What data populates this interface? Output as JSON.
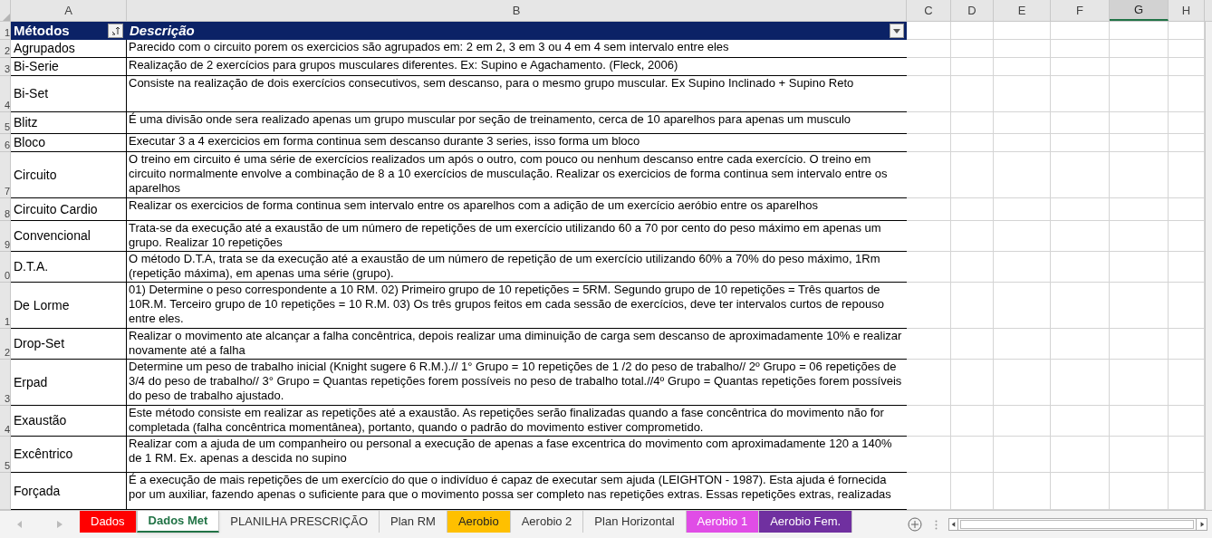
{
  "column_headers": [
    {
      "label": "A",
      "selected": false
    },
    {
      "label": "B",
      "selected": false
    },
    {
      "label": "C",
      "selected": false
    },
    {
      "label": "D",
      "selected": false
    },
    {
      "label": "E",
      "selected": false
    },
    {
      "label": "F",
      "selected": false
    },
    {
      "label": "G",
      "selected": true
    },
    {
      "label": "H",
      "selected": false
    }
  ],
  "table": {
    "header_row_number": "1",
    "columns": [
      "Métodos",
      "Descrição"
    ],
    "rows": [
      {
        "row_number": "2",
        "method": "Agrupados",
        "description": "Parecido com o circuito porem os exercicios são agrupados em: 2 em 2, 3 em 3 ou 4 em 4 sem intervalo entre eles"
      },
      {
        "row_number": "3",
        "method": "Bi-Serie",
        "description": "Realização de 2 exercícios para grupos musculares diferentes. Ex: Supino e Agachamento. (Fleck, 2006)"
      },
      {
        "row_number": "4",
        "method": "Bi-Set",
        "description": "Consiste na realização de dois exercícios consecutivos, sem descanso, para o mesmo grupo muscular. Ex Supino Inclinado + Supino Reto"
      },
      {
        "row_number": "5",
        "method": "Blitz",
        "description": "É uma divisão onde sera realizado apenas um grupo muscular por seção de treinamento, cerca de 10 aparelhos para apenas um musculo"
      },
      {
        "row_number": "6",
        "method": "Bloco",
        "description": "Executar 3 a 4 exercicios em forma continua sem descanso durante 3 series, isso forma um bloco"
      },
      {
        "row_number": "7",
        "method": "Circuito",
        "description": "O treino em circuito é uma série de exercícios realizados um após o outro, com pouco ou nenhum descanso entre cada exercício. O treino em circuito normalmente envolve a combinação de 8 a 10 exercícios de musculação. Realizar os exercicios de forma continua sem intervalo entre os aparelhos"
      },
      {
        "row_number": "8",
        "method": "Circuito Cardio",
        "description": "Realizar os exercicios de forma continua sem intervalo entre os aparelhos com a adição de um exercício aeróbio entre os aparelhos"
      },
      {
        "row_number": "9",
        "method": "Convencional",
        "description": "Trata-se da execução até a exaustão de um número de repetições de um exercício utilizando 60 a 70 por cento do peso máximo em apenas um grupo. Realizar 10 repetições"
      },
      {
        "row_number": "0",
        "method": "D.T.A.",
        "description": "O método D.T.A, trata se da execução até a exaustão de um número de repetição de um exercício utilizando 60% a 70% do peso máximo, 1Rm (repetição máxima), em apenas uma série (grupo)."
      },
      {
        "row_number": "1",
        "method": "De Lorme",
        "description": "01) Determine o peso correspondente a 10 RM. 02) Primeiro grupo de 10 repetições = 5RM. Segundo grupo de 10 repetições = Três quartos de 10R.M. Terceiro grupo de 10 repetições = 10 R.M. 03) Os três grupos feitos em cada sessão de exercícios, deve ter intervalos curtos de repouso entre eles."
      },
      {
        "row_number": "2",
        "method": "Drop-Set",
        "description": "Realizar o movimento ate alcançar a falha concêntrica, depois realizar uma diminuição de carga sem descanso de aproximadamente 10% e realizar novamente até a falha"
      },
      {
        "row_number": "3",
        "method": "Erpad",
        "description": "Determine um peso de trabalho inicial (Knight sugere 6 R.M.).// 1° Grupo = 10 repetições de 1 /2 do peso de trabalho// 2º Grupo = 06 repetições de 3/4 do peso de trabalho// 3° Grupo = Quantas repetições forem possíveis no peso de trabalho total.//4º Grupo = Quantas repetições forem possíveis do peso de trabalho ajustado."
      },
      {
        "row_number": "4",
        "method": "Exaustão",
        "description": "Este método consiste em realizar as repetições até a exaustão. As repetições serão finalizadas quando a fase concêntrica do movimento não for completada (falha concêntrica momentânea), portanto, quando o padrão do movimento estiver comprometido."
      },
      {
        "row_number": "5",
        "method": "Excêntrico",
        "description": "Realizar com a ajuda de um companheiro ou personal a execução de apenas a fase excentrica do movimento com aproximadamente 120 a 140% de 1 RM. Ex. apenas a descida no supino"
      },
      {
        "method": "Forçada",
        "description": "É a execução de mais repetições de um exercício do que o indivíduo é capaz de executar sem ajuda (LEIGHTON - 1987). Esta ajuda é fornecida por um auxiliar, fazendo apenas o suficiente para que o movimento possa ser completo nas repetições extras. Essas repetições extras, realizadas"
      }
    ]
  },
  "sheet_tabs": [
    {
      "label": "Dados",
      "selected": false,
      "color": "#ff0000"
    },
    {
      "label": "Dados Met",
      "selected": true
    },
    {
      "label": "PLANILHA PRESCRIÇÃO",
      "selected": false
    },
    {
      "label": "Plan RM",
      "selected": false
    },
    {
      "label": "Aerobio",
      "selected": false,
      "color": "#ffc000"
    },
    {
      "label": "Aerobio 2",
      "selected": false
    },
    {
      "label": "Plan Horizontal",
      "selected": false
    },
    {
      "label": "Aerobio 1",
      "selected": false,
      "color": "#e04de6"
    },
    {
      "label": "Aerobio Fem.",
      "selected": false,
      "color": "#7030a0"
    }
  ]
}
